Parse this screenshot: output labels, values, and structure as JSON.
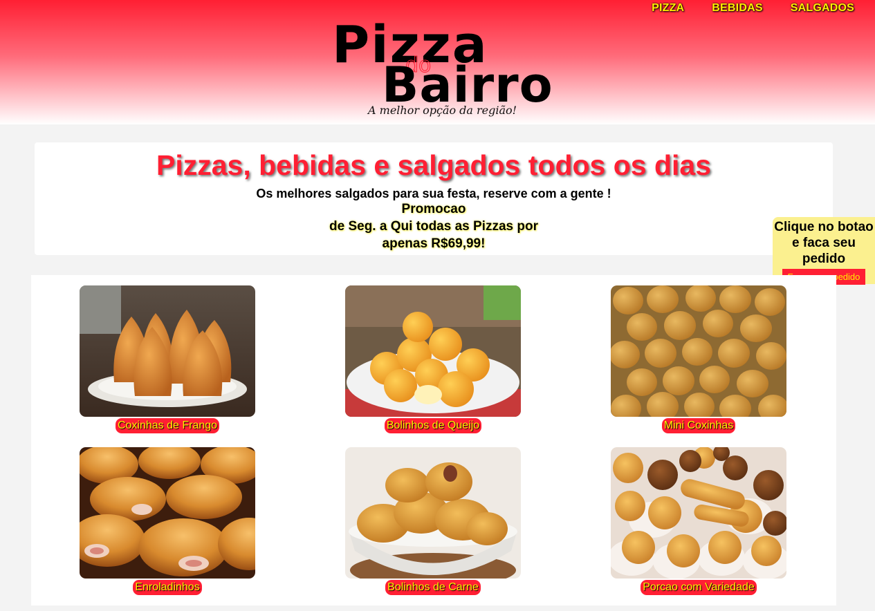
{
  "nav": {
    "items": [
      "PIZZA",
      "BEBIDAS",
      "SALGADOS"
    ]
  },
  "logo": {
    "line1": "Pizza",
    "line2": "do",
    "line3": "Bairro",
    "tagline": "A melhor opção da região!"
  },
  "banner": {
    "title": "Pizzas, bebidas e salgados todos os dias",
    "subtitle": "Os melhores salgados para sua festa, reserve com a gente !",
    "promo_line1": "Promocao",
    "promo_line2": "de Seg. a Qui todas as Pizzas por",
    "promo_line3": "apenas R$69,99!"
  },
  "side_widget": {
    "text": "Clique no botao e faca seu pedido",
    "button_label": "Fazer meu pedido"
  },
  "products": [
    {
      "label": "Coxinhas de Frango",
      "image": "coxinhas-image"
    },
    {
      "label": "Bolinhos de Queijo",
      "image": "bolinhos-queijo-image"
    },
    {
      "label": "Mini Coxinhas",
      "image": "mini-coxinhas-image"
    },
    {
      "label": "Enroladinhos",
      "image": "enroladinhos-image"
    },
    {
      "label": "Bolinhos de Carne",
      "image": "bolinhos-carne-image"
    },
    {
      "label": "Porcao com Variedade",
      "image": "porcao-variedade-image"
    }
  ],
  "colors": {
    "brand_red": "#ff1f33",
    "accent_yellow": "#ffee00",
    "widget_yellow": "#fbf08f"
  }
}
